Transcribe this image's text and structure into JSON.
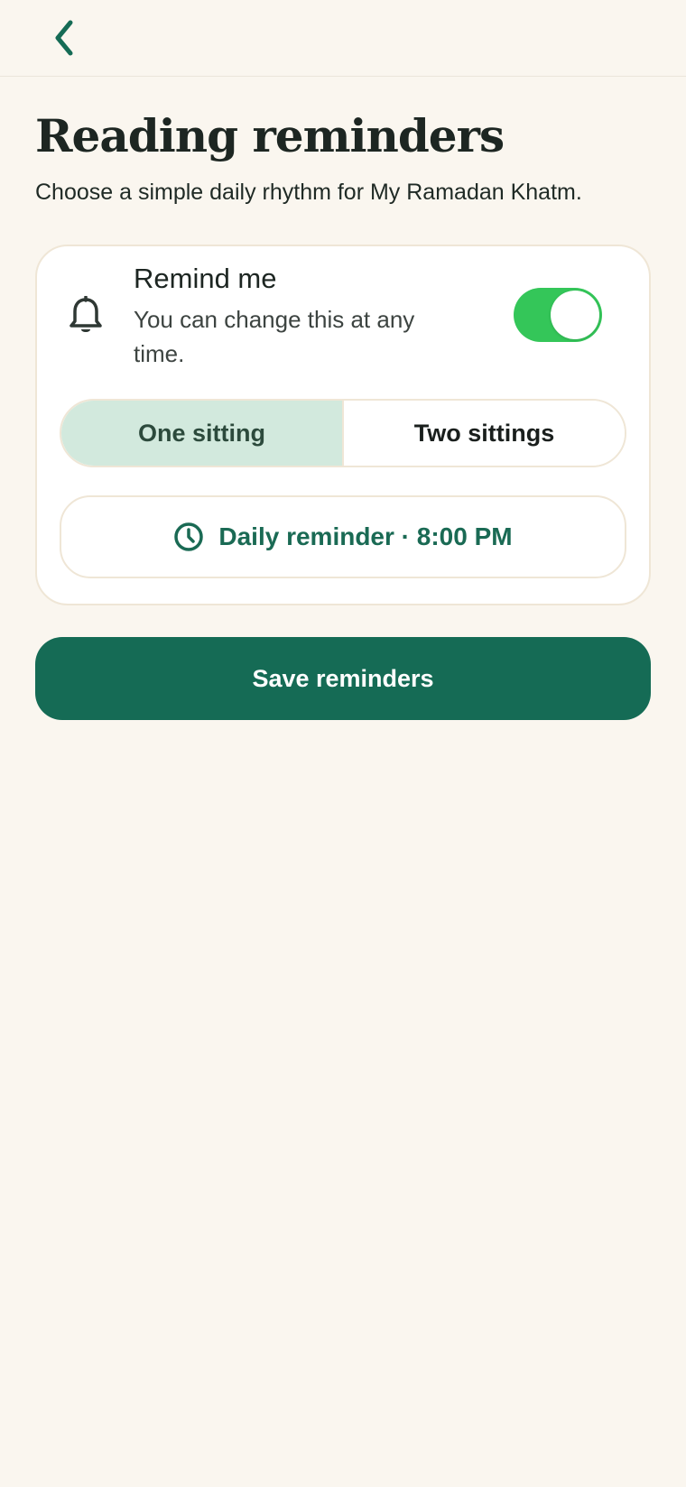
{
  "header": {
    "back_icon": "chevron-left-icon"
  },
  "page": {
    "title": "Reading reminders",
    "subtitle": "Choose a simple daily rhythm for My Ramadan Khatm."
  },
  "reminder_card": {
    "icon": "bell-icon",
    "title": "Remind me",
    "description": "You can change this at any time.",
    "toggle_on": true,
    "toggle_color": "#34c659",
    "segments": [
      {
        "label": "One sitting",
        "selected": true
      },
      {
        "label": "Two sittings",
        "selected": false
      }
    ],
    "daily_icon": "clock-icon",
    "daily_label": "Daily reminder · 8:00 PM"
  },
  "actions": {
    "save_label": "Save reminders"
  },
  "colors": {
    "background": "#faf6ef",
    "accent": "#156b55",
    "selected_segment": "#d2e9dd"
  }
}
